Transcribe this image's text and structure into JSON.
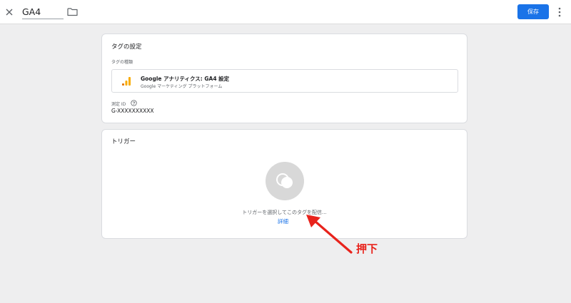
{
  "header": {
    "title": "GA4",
    "save_label": "保存",
    "icons": [
      "close-icon",
      "folder-icon",
      "more-vert-icon"
    ]
  },
  "tag_settings": {
    "title": "タグの設定",
    "tag_type_label": "タグの種類",
    "tag_type": {
      "name": "Google アナリティクス: GA4 設定",
      "provider": "Google マーケティング プラットフォーム",
      "icon": "analytics-bars-icon"
    },
    "measurement_id_label": "測定 ID",
    "measurement_id": "G-XXXXXXXXXX"
  },
  "triggers": {
    "title": "トリガー",
    "empty_text": "トリガーを選択してこのタグを配信...",
    "learn_more": "詳細",
    "icon": "trigger-circles-icon"
  },
  "annotation": {
    "label": "押下",
    "color": "#e8231c"
  },
  "colors": {
    "accent": "#1a73e8",
    "background": "#eeeeef",
    "analytics_orange": "#f9ab00",
    "analytics_dark_orange": "#e37400"
  }
}
